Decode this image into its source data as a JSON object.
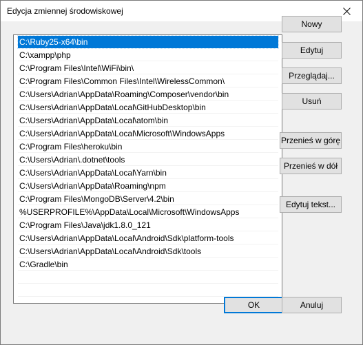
{
  "window": {
    "title": "Edycja zmiennej środowiskowej"
  },
  "paths": [
    "C:\\Ruby25-x64\\bin",
    "C:\\xampp\\php",
    "C:\\Program Files\\Intel\\WiFi\\bin\\",
    "C:\\Program Files\\Common Files\\Intel\\WirelessCommon\\",
    "C:\\Users\\Adrian\\AppData\\Roaming\\Composer\\vendor\\bin",
    "C:\\Users\\Adrian\\AppData\\Local\\GitHubDesktop\\bin",
    "C:\\Users\\Adrian\\AppData\\Local\\atom\\bin",
    "C:\\Users\\Adrian\\AppData\\Local\\Microsoft\\WindowsApps",
    "C:\\Program Files\\heroku\\bin",
    "C:\\Users\\Adrian\\.dotnet\\tools",
    "C:\\Users\\Adrian\\AppData\\Local\\Yarn\\bin",
    "C:\\Users\\Adrian\\AppData\\Roaming\\npm",
    "C:\\Program Files\\MongoDB\\Server\\4.2\\bin",
    "%USERPROFILE%\\AppData\\Local\\Microsoft\\WindowsApps",
    "C:\\Program Files\\Java\\jdk1.8.0_121",
    "C:\\Users\\Adrian\\AppData\\Local\\Android\\Sdk\\platform-tools",
    "C:\\Users\\Adrian\\AppData\\Local\\Android\\Sdk\\tools",
    "C:\\Gradle\\bin"
  ],
  "selected_index": 0,
  "buttons": {
    "new": "Nowy",
    "edit": "Edytuj",
    "browse": "Przeglądaj...",
    "delete": "Usuń",
    "move_up": "Przenieś w górę",
    "move_down": "Przenieś w dół",
    "edit_text": "Edytuj tekst...",
    "ok": "OK",
    "cancel": "Anuluj"
  },
  "colors": {
    "selection": "#0078d7",
    "button_face": "#e1e1e1",
    "dialog_bg": "#f0f0f0"
  }
}
